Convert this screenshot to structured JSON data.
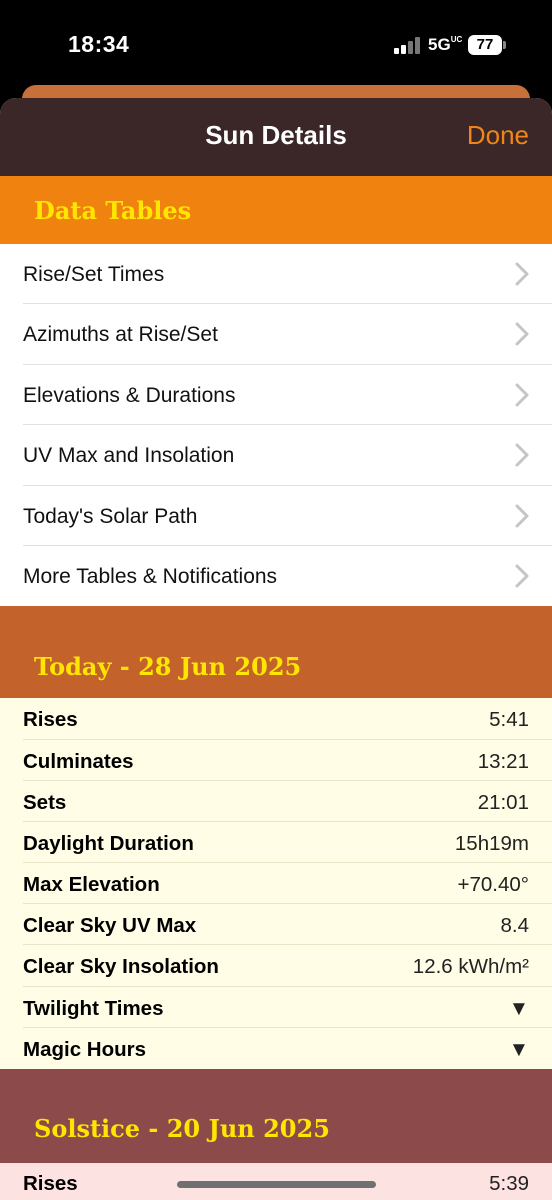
{
  "status": {
    "time": "18:34",
    "network": "5G",
    "network_badge": "UC",
    "battery": "77"
  },
  "nav": {
    "title": "Sun Details",
    "done_label": "Done"
  },
  "data_tables": {
    "header": "Data Tables",
    "items": [
      {
        "label": "Rise/Set Times"
      },
      {
        "label": "Azimuths at Rise/Set"
      },
      {
        "label": "Elevations & Durations"
      },
      {
        "label": "UV Max and Insolation"
      },
      {
        "label": "Today's Solar Path"
      },
      {
        "label": "More Tables & Notifications"
      }
    ]
  },
  "today": {
    "header": "Today - 28 Jun 2025",
    "rows": [
      {
        "label": "Rises",
        "value": "5:41"
      },
      {
        "label": "Culminates",
        "value": "13:21"
      },
      {
        "label": "Sets",
        "value": "21:01"
      },
      {
        "label": "Daylight Duration",
        "value": "15h19m"
      },
      {
        "label": "Max Elevation",
        "value": "+70.40°"
      },
      {
        "label": "Clear Sky UV Max",
        "value": "8.4"
      },
      {
        "label": "Clear Sky Insolation",
        "value": "12.6 kWh/m²"
      },
      {
        "label": "Twilight Times",
        "value": "▼"
      },
      {
        "label": "Magic Hours",
        "value": "▼"
      }
    ]
  },
  "solstice": {
    "header": "Solstice - 20 Jun 2025",
    "rows": [
      {
        "label": "Rises",
        "value": "5:39"
      }
    ]
  },
  "colors": {
    "nav_bg": "#3b2628",
    "accent": "#f0861a",
    "data_tables_bg": "#f08310",
    "today_bg": "#c4622c",
    "solstice_bg": "#8d4a4a",
    "header_text": "#ffe600",
    "today_rows_bg": "#fffde6",
    "solstice_rows_bg": "#fde2e2"
  }
}
